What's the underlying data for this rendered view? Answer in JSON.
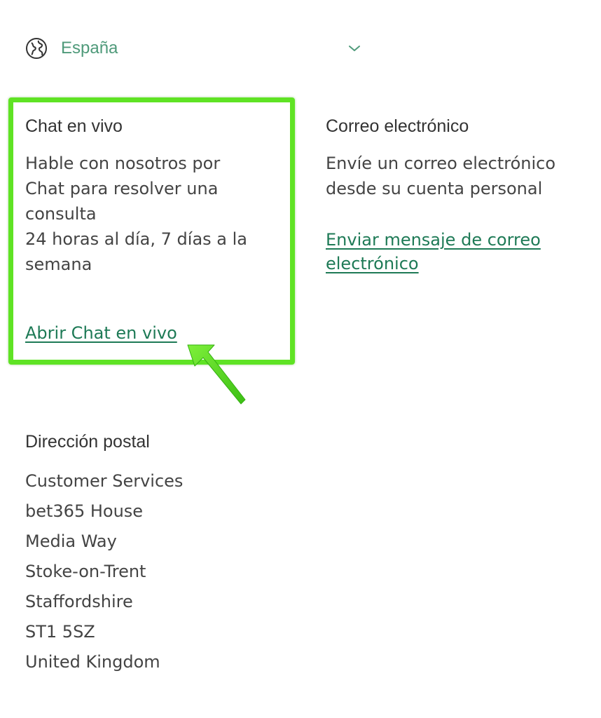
{
  "country_selector": {
    "icon": "globe-icon",
    "selected": "España",
    "chevron_icon": "chevron-down-icon"
  },
  "live_chat": {
    "title": "Chat en vivo",
    "description": "Hable con nosotros por\nChat para resolver una\nconsulta\n24 horas al día, 7 días a la\nsemana",
    "link_label": "Abrir Chat en vivo"
  },
  "email": {
    "title": "Correo electrónico",
    "description": "Envíe un correo electrónico\ndesde su cuenta personal",
    "link_label": "Enviar mensaje de correo\nelectrónico"
  },
  "postal": {
    "title": "Dirección postal",
    "lines": [
      "Customer Services",
      "bet365 House",
      "Media Way",
      "Stoke-on-Trent",
      "Staffordshire",
      "ST1 5SZ",
      "United Kingdom"
    ]
  },
  "colors": {
    "accent_green": "#1e7a56",
    "country_text": "#4f9a7a",
    "highlight": "#5fe324"
  }
}
